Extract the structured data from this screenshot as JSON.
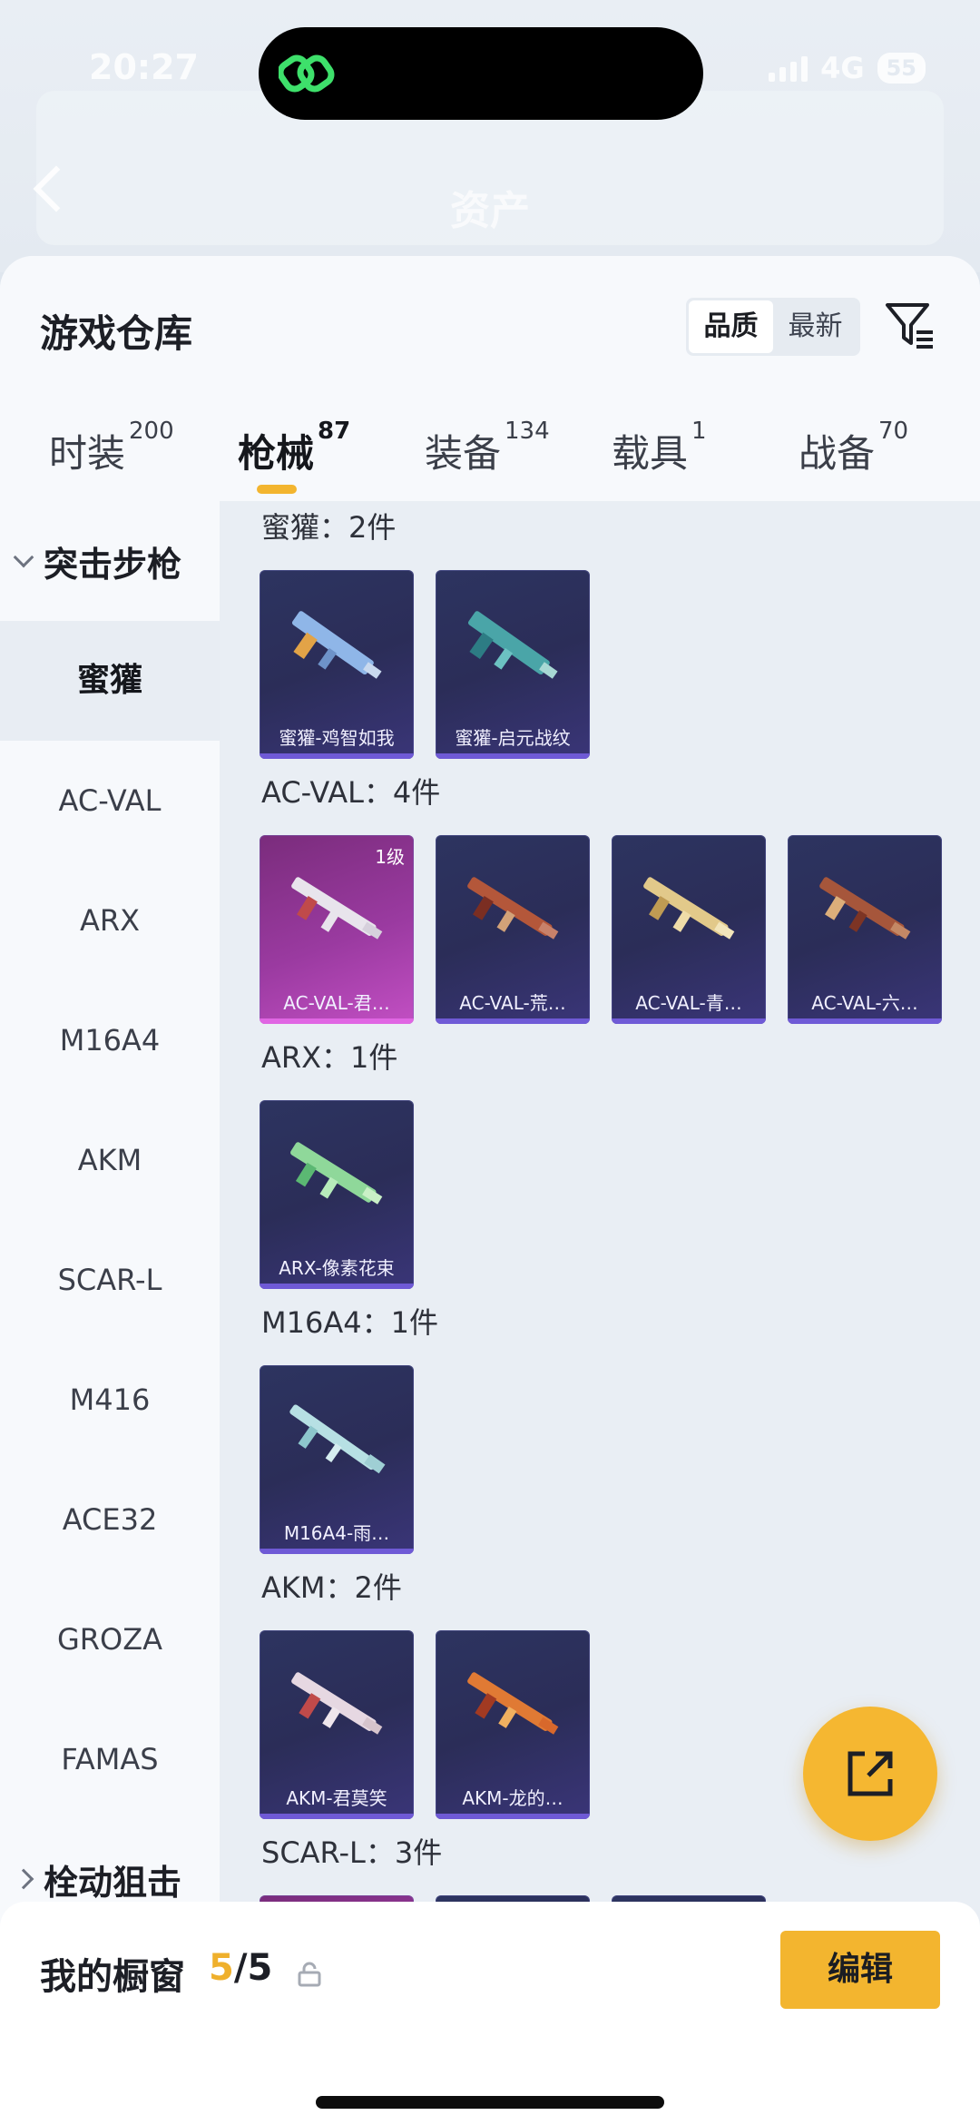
{
  "status_bar": {
    "time": "20:27",
    "network": "4G",
    "battery": "55"
  },
  "background_header": {
    "title": "资产"
  },
  "sheet": {
    "title": "游戏仓库",
    "sort_options": [
      "品质",
      "最新"
    ],
    "tabs": [
      {
        "label": "时装",
        "count": "200"
      },
      {
        "label": "枪械",
        "count": "87"
      },
      {
        "label": "装备",
        "count": "134"
      },
      {
        "label": "载具",
        "count": "1"
      },
      {
        "label": "战备",
        "count": "70"
      }
    ]
  },
  "category_nav": {
    "group_open": "突击步枪",
    "items": [
      "蜜獾",
      "AC-VAL",
      "ARX",
      "M16A4",
      "AKM",
      "SCAR-L",
      "M416",
      "ACE32",
      "GROZA",
      "FAMAS"
    ],
    "group_closed": "栓动狙击"
  },
  "groups": [
    {
      "label": "蜜獾：2件",
      "items": [
        {
          "name": "蜜獾-鸡智如我"
        },
        {
          "name": "蜜獾-启元战纹"
        }
      ]
    },
    {
      "label": "AC-VAL：4件",
      "items": [
        {
          "name": "AC-VAL-君…",
          "level": "1级"
        },
        {
          "name": "AC-VAL-荒…"
        },
        {
          "name": "AC-VAL-青…"
        },
        {
          "name": "AC-VAL-六…"
        }
      ]
    },
    {
      "label": "ARX：1件",
      "items": [
        {
          "name": "ARX-像素花束"
        }
      ]
    },
    {
      "label": "M16A4：1件",
      "items": [
        {
          "name": "M16A4-雨…"
        }
      ]
    },
    {
      "label": "AKM：2件",
      "items": [
        {
          "name": "AKM-君莫笑"
        },
        {
          "name": "AKM-龙的…"
        }
      ]
    },
    {
      "label": "SCAR-L：3件",
      "items": []
    }
  ],
  "bottom_bar": {
    "title": "我的橱窗",
    "current": "5",
    "separator": "/",
    "max": "5",
    "edit_label": "编辑"
  },
  "colors": {
    "accent": "#f3b52f",
    "card_bg": "#2d3460",
    "card_highlight": "#9a3aa0"
  },
  "icons": [
    "back-icon",
    "filter-icon",
    "chevron-down-icon",
    "chevron-right-icon",
    "share-icon",
    "lock-icon",
    "app-logo-icon"
  ]
}
